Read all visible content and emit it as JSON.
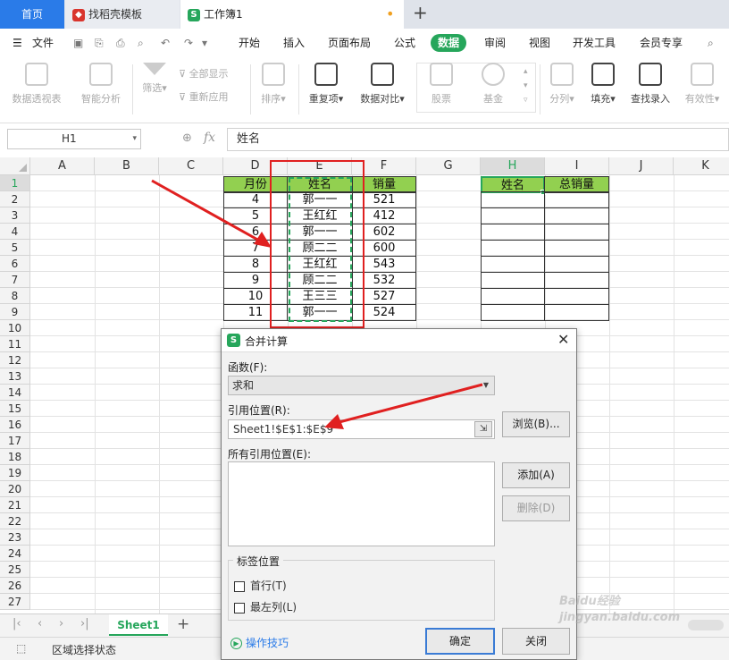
{
  "tabs": {
    "home": "首页",
    "template": "找稻壳模板",
    "workbook": "工作簿1",
    "add": "+"
  },
  "menu": {
    "file": "文件",
    "items": [
      "开始",
      "插入",
      "页面布局",
      "公式",
      "数据",
      "审阅",
      "视图",
      "开发工具",
      "会员专享"
    ],
    "active": "数据"
  },
  "ribbon": {
    "pivot": "数据透视表",
    "smart": "智能分析",
    "filter": "筛选",
    "show_all": "全部显示",
    "reapply": "重新应用",
    "sort": "排序",
    "duplicates": "重复项",
    "compare": "数据对比",
    "stock": "股票",
    "fund": "基金",
    "split": "分列",
    "fill": "填充",
    "lookup": "查找录入",
    "validity": "有效性"
  },
  "formula_bar": {
    "name_box": "H1",
    "fx": "fx",
    "content": "姓名"
  },
  "grid": {
    "columns": [
      "A",
      "B",
      "C",
      "D",
      "E",
      "F",
      "G",
      "H",
      "I",
      "J",
      "K"
    ],
    "rows": [
      "1",
      "2",
      "3",
      "4",
      "5",
      "6",
      "7",
      "8",
      "9",
      "10",
      "11",
      "12",
      "13",
      "14",
      "15",
      "16",
      "17",
      "18",
      "19",
      "20",
      "21",
      "22",
      "23",
      "24",
      "25",
      "26",
      "27"
    ],
    "table1_headers": [
      "月份",
      "姓名",
      "销量"
    ],
    "table1_rows": [
      [
        "4",
        "郭一一",
        "521"
      ],
      [
        "5",
        "王红红",
        "412"
      ],
      [
        "6",
        "郭一一",
        "602"
      ],
      [
        "7",
        "顾二二",
        "600"
      ],
      [
        "8",
        "王红红",
        "543"
      ],
      [
        "9",
        "顾二二",
        "532"
      ],
      [
        "10",
        "王三三",
        "527"
      ],
      [
        "11",
        "郭一一",
        "524"
      ]
    ],
    "table2_headers": [
      "姓名",
      "总销量"
    ]
  },
  "dialog": {
    "title": "合并计算",
    "function_label": "函数(F):",
    "function_value": "求和",
    "ref_label": "引用位置(R):",
    "ref_value": "Sheet1!$E$1:$E$9",
    "browse": "浏览(B)...",
    "all_refs_label": "所有引用位置(E):",
    "add": "添加(A)",
    "delete": "删除(D)",
    "label_pos": "标签位置",
    "first_row": "首行(T)",
    "left_col": "最左列(L)",
    "tips": "操作技巧",
    "ok": "确定",
    "close": "关闭"
  },
  "sheet_tab": "Sheet1",
  "status": "区域选择状态",
  "watermark": "Baidu经验 jingyan.baidu.com",
  "colors": {
    "accent": "#26a65b",
    "header_green": "#92d050",
    "annotation_red": "#e02020",
    "tab_blue": "#2a7be8"
  }
}
